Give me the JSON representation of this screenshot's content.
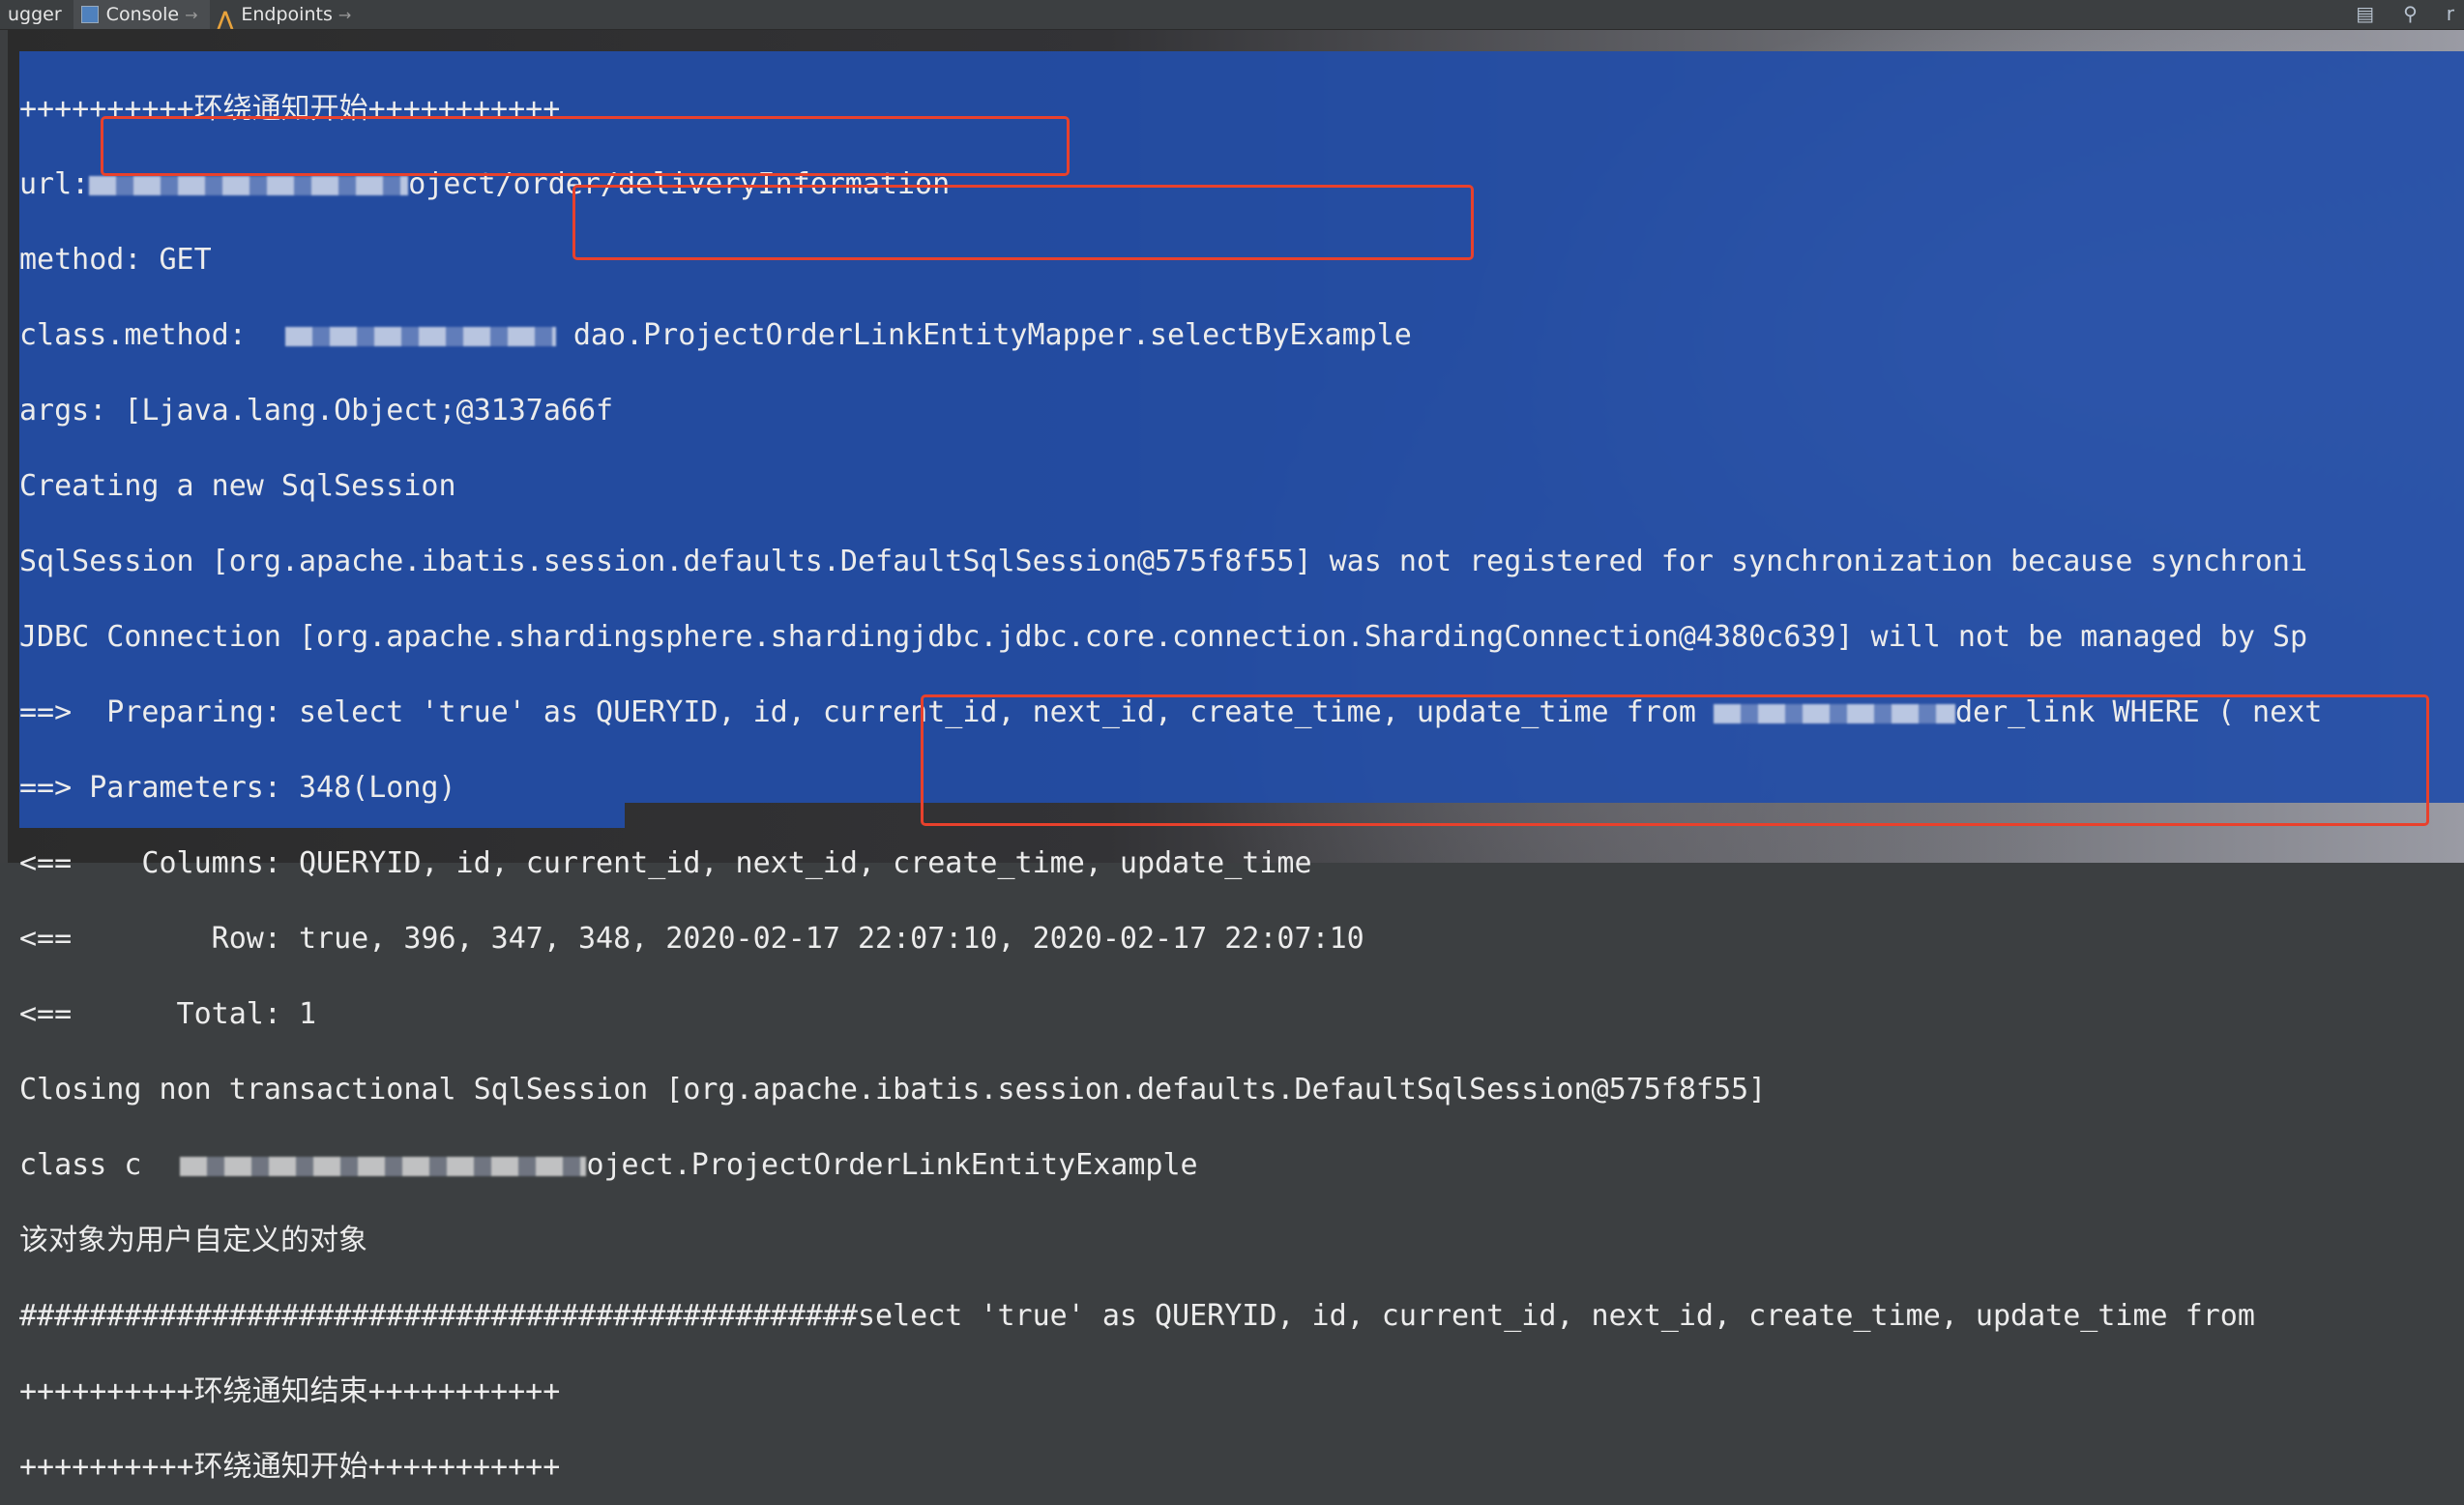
{
  "toolbar": {
    "tabs": [
      {
        "label": "ugger",
        "pin": ""
      },
      {
        "label": "Console",
        "pin": "→"
      },
      {
        "label": "Endpoints",
        "pin": "→"
      }
    ],
    "right_icons": [
      "build-icon",
      "search-icon",
      "r"
    ]
  },
  "log_lines": [
    "++++++++++环绕通知开始+++++++++++",
    "url:",
    "oject/order/deliveryInformation",
    "method: GET",
    "class.method:",
    "dao",
    ".ProjectOrderLinkEntityMapper.selectByExample",
    "args: [Ljava.lang.Object;@3137a66f",
    "Creating a new SqlSession",
    "SqlSession [org.apache.ibatis.session.defaults.DefaultSqlSession@575f8f55] was not registered for synchronization because synchroni",
    "JDBC Connection [org.apache.shardingsphere.shardingjdbc.jdbc.core.connection.ShardingConnection@4380c639] will not be managed by Sp",
    "==>  Preparing: select 'true' as QUERYID, id, current_id, next_id, create_time, update_time from ",
    "der_link WHERE ( next",
    "==> Parameters: 348(Long)",
    "<==    Columns: QUERYID, id, current_id, next_id, create_time, update_time",
    "<==        Row: true, 396, 347, 348, 2020-02-17 22:07:10, 2020-02-17 22:07:10",
    "<==      Total: 1",
    "Closing non transactional SqlSession [org.apache.ibatis.session.defaults.DefaultSqlSession@575f8f55]",
    "class c",
    "oject.ProjectOrderLinkEntityExample",
    "该对象为用户自定义的对象",
    "################################################select 'true' as QUERYID, id, current_id, next_id, create_time, update_time from",
    "++++++++++环绕通知结束+++++++++++",
    "++++++++++环绕通知开始+++++++++++"
  ],
  "colors": {
    "selection": "#224da8",
    "highlight_box": "#e8412c",
    "text": "#ececec"
  }
}
